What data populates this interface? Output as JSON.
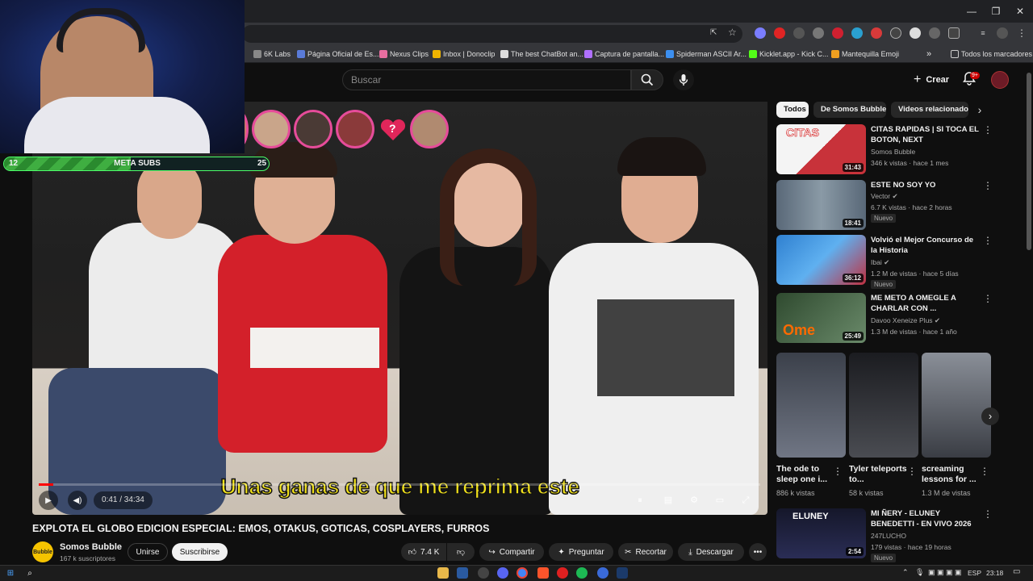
{
  "browser": {
    "window_controls": [
      "—",
      "❐",
      "✕"
    ],
    "bookmarks": [
      {
        "label": "6K Labs",
        "color": "#888888"
      },
      {
        "label": "Página Oficial de Es...",
        "color": "#5a7bd8"
      },
      {
        "label": "Nexus Clips",
        "color": "#e86ea0"
      },
      {
        "label": "Inbox | Donoclip",
        "color": "#f0b400"
      },
      {
        "label": "The best ChatBot an...",
        "color": "#dddddd"
      },
      {
        "label": "Captura de pantalla...",
        "color": "#b070ff"
      },
      {
        "label": "Spiderman ASCII Ar...",
        "color": "#3c8ff0"
      },
      {
        "label": "Kicklet.app - Kick C...",
        "color": "#53fc18"
      },
      {
        "label": "Mantequilla Emoji",
        "color": "#f0a020"
      }
    ],
    "bookmarks_more": "»",
    "all_bookmarks": "Todos los marcadores"
  },
  "youtube": {
    "search_placeholder": "Buscar",
    "create_label": "Crear",
    "notification_badge": "9+"
  },
  "overlay": {
    "meta_label": "META SUBS",
    "meta_current": "12",
    "meta_goal": "25",
    "meta_progress": 0.48,
    "question_mark": "?"
  },
  "player": {
    "subtitle": "Unas ganas de que me reprima este",
    "time": "0:41 / 34:34",
    "progress": 0.02
  },
  "video": {
    "title": "EXPLOTA EL GLOBO EDICION ESPECIAL: EMOS, OTAKUS, GOTICAS, COSPLAYERS, FURROS",
    "channel": "Somos Bubble",
    "channel_avatar_text": "Bubble",
    "subscribers": "167 k suscriptores",
    "join_label": "Unirse",
    "subscribe_label": "Suscribirse",
    "likes": "7.4 K",
    "share_label": "Compartir",
    "ask_label": "Preguntar",
    "clip_label": "Recortar",
    "download_label": "Descargar"
  },
  "chips": [
    "Todos",
    "De Somos Bubble",
    "Videos relacionados"
  ],
  "recommendations": [
    {
      "title": "CITAS RAPIDAS | SI TOCA EL BOTON, NEXT",
      "channel": "Somos Bubble",
      "meta": "346 k vistas · hace 1 mes",
      "duration": "31:43",
      "badge": "",
      "thumb_color": "#c8323a"
    },
    {
      "title": "ESTE NO SOY YO",
      "channel": "Vector ✔",
      "meta": "6.7 K vistas · hace 2 horas",
      "duration": "18:41",
      "badge": "Nuevo",
      "thumb_color": "#5b6a7a"
    },
    {
      "title": "Volvió el Mejor Concurso de la Historia",
      "channel": "Ibai ✔",
      "meta": "1.2 M de vistas · hace 5 días",
      "duration": "36:12",
      "badge": "Nuevo",
      "thumb_color": "#2f80d0"
    },
    {
      "title": "ME METO A OMEGLE A CHARLAR CON ...",
      "channel": "Davoo Xeneize Plus ✔",
      "meta": "1.3 M de vistas · hace 1 año",
      "duration": "25:49",
      "badge": "",
      "thumb_color": "#3a5a3a"
    }
  ],
  "shorts": [
    {
      "title": "The ode to sleep one i...",
      "views": "886 k vistas",
      "color": "#4a4f5a"
    },
    {
      "title": "Tyler teleports to...",
      "views": "58 k vistas",
      "color": "#2d2f34"
    },
    {
      "title": "screaming lessons for ...",
      "views": "1.3 M de vistas",
      "color": "#6a6f78"
    }
  ],
  "last_rec": {
    "title": "MI ÑERY - ELUNEY BENEDETTI - EN VIVO 2026",
    "channel": "247LUCHO",
    "meta": "179 vistas · hace 19 horas",
    "duration": "2:54",
    "badge": "Nuevo",
    "thumb_label": "ELUNEY"
  },
  "taskbar": {
    "lang": "ESP",
    "clock": "23:18"
  }
}
